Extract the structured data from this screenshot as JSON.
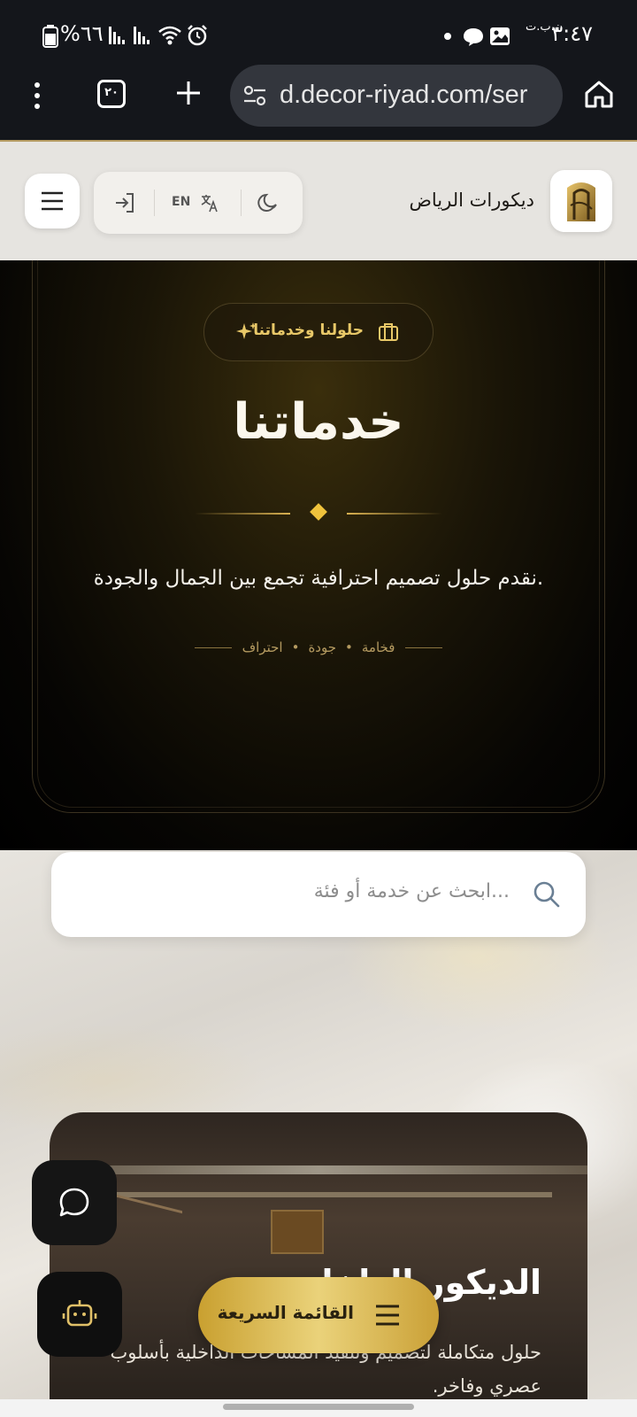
{
  "status_bar": {
    "time": "٣:٤٧",
    "carrier_label": "ن.ب.ت",
    "battery_percent": "%٦٦"
  },
  "browser": {
    "url": "d.decor-riyad.com/ser",
    "tab_count": "٢٠"
  },
  "header": {
    "brand_name": "ديكورات الرياض",
    "language_label": "EN"
  },
  "hero": {
    "badge_label": "حلولنا وخدماتنا",
    "title": "خدماتنا",
    "subtitle": "نقدم حلول تصميم احترافية تجمع بين الجمال والجودة.",
    "tags": [
      "فخامة",
      "جودة",
      "احتراف"
    ]
  },
  "search": {
    "placeholder": "ابحث عن خدمة أو فئة..."
  },
  "service_card": {
    "title": "الديكور الداخلي",
    "description": "حلول متكاملة لتصميم وتنفيذ المساحات الداخلية بأسلوب عصري وفاخر."
  },
  "quick_menu": {
    "label": "القائمة السريعة"
  },
  "colors": {
    "gold": "#e8c868",
    "dark": "#14161b"
  }
}
